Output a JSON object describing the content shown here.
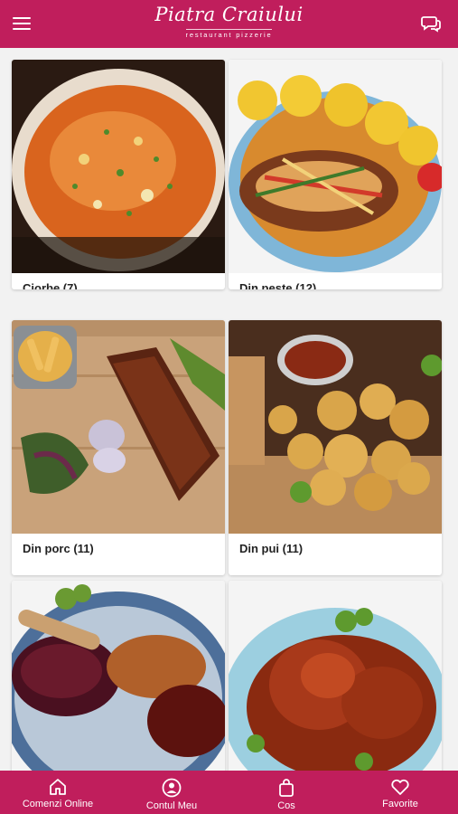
{
  "header": {
    "logo_title": "Piatra Craiului",
    "logo_subtitle": "restaurant  pizzerie"
  },
  "categories": [
    {
      "name": "Ciorbe",
      "count": "(7)"
    },
    {
      "name": "Din pește",
      "count": "(12)"
    },
    {
      "name": "Din porc",
      "count": "(11)"
    },
    {
      "name": "Din pui",
      "count": "(11)"
    },
    {
      "name": "",
      "count": ""
    },
    {
      "name": "",
      "count": ""
    }
  ],
  "bottom_nav": [
    {
      "label": "Comenzi Online",
      "icon": "home-icon"
    },
    {
      "label": "Contul Meu",
      "icon": "user-icon"
    },
    {
      "label": "Cos",
      "icon": "shopping-bag-icon"
    },
    {
      "label": "Favorite",
      "icon": "heart-icon"
    }
  ],
  "colors": {
    "brand": "#c01e5c",
    "background": "#f2f2f2",
    "card": "#ffffff"
  }
}
